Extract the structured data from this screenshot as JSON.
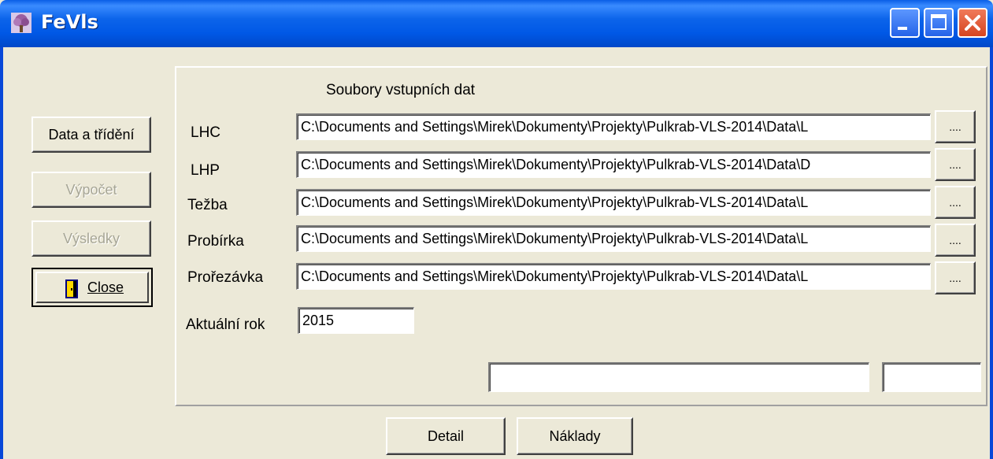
{
  "window": {
    "title": "FeVls",
    "icon": "tree-icon",
    "controls": [
      "minimize-icon",
      "maximize-icon",
      "close-icon"
    ]
  },
  "sidebar": {
    "buttons": [
      {
        "label": "Data a třídění",
        "enabled": true
      },
      {
        "label": "Výpočet",
        "enabled": false
      },
      {
        "label": "Výsledky",
        "enabled": false
      }
    ],
    "close": {
      "label": "Close",
      "icon": "door-exit-icon"
    }
  },
  "files": {
    "heading": "Soubory vstupních dat",
    "browse_label": "....",
    "rows": [
      {
        "label": "LHC",
        "value": "C:\\Documents and Settings\\Mirek\\Dokumenty\\Projekty\\Pulkrab-VLS-2014\\Data\\L"
      },
      {
        "label": "LHP",
        "value": "C:\\Documents and Settings\\Mirek\\Dokumenty\\Projekty\\Pulkrab-VLS-2014\\Data\\D"
      },
      {
        "label": "Težba",
        "value": "C:\\Documents and Settings\\Mirek\\Dokumenty\\Projekty\\Pulkrab-VLS-2014\\Data\\L"
      },
      {
        "label": "Probírka",
        "value": "C:\\Documents and Settings\\Mirek\\Dokumenty\\Projekty\\Pulkrab-VLS-2014\\Data\\L"
      },
      {
        "label": "Prořezávka",
        "value": "C:\\Documents and Settings\\Mirek\\Dokumenty\\Projekty\\Pulkrab-VLS-2014\\Data\\L"
      }
    ]
  },
  "year": {
    "label": "Aktuální rok",
    "value": "2015"
  },
  "status": {
    "field1": "",
    "field2": ""
  },
  "footer": {
    "detail_label": "Detail",
    "costs_label": "Náklady"
  }
}
